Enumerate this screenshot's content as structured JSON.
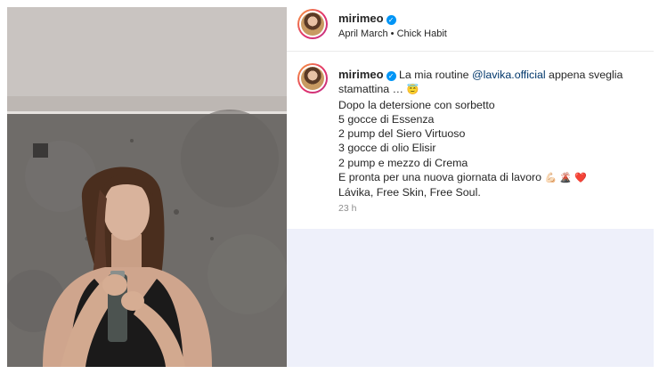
{
  "header": {
    "username": "mirimeo",
    "subtitle": "April March • Chick Habit"
  },
  "caption": {
    "username": "mirimeo",
    "intro_before": "La mia routine ",
    "mention": "@lavika.official",
    "intro_after": " appena sveglia",
    "line2": "stamattina …",
    "line2_emoji": "😇",
    "steps": [
      "Dopo la detersione con sorbetto",
      "5 gocce di Essenza",
      "2 pump del Siero Virtuoso",
      "3 gocce di olio Elisir",
      "2 pump e mezzo di Crema"
    ],
    "closing": "E pronta per una nuova giornata di lavoro",
    "closing_emojis": "💪🏻 🌋 ❤️",
    "signoff": "Lávika, Free Skin, Free Soul.",
    "timestamp": "23 h"
  },
  "icons": {
    "verified": "verified-badge-icon",
    "avatar": "profile-avatar"
  },
  "colors": {
    "verified": "#0095f6",
    "mention": "#00376b",
    "lower_panel": "#eef0fa"
  }
}
